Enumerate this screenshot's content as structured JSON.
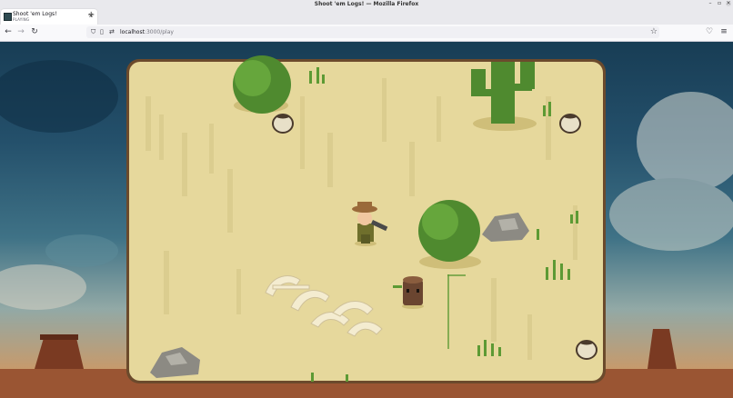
{
  "window": {
    "title": "Shoot 'em Logs! — Mozilla Firefox"
  },
  "tab": {
    "title": "Shoot 'em Logs!",
    "subtitle": "PLAYING",
    "close_icon": "close-icon"
  },
  "toolbar": {
    "back_icon": "back-arrow-icon",
    "forward_icon": "forward-arrow-icon",
    "reload_icon": "reload-icon",
    "pocket_icon": "pocket-icon",
    "menu_icon": "menu-icon"
  },
  "urlbar": {
    "host": "localhost",
    "path": ":3000/play",
    "shield_icon": "shield-icon",
    "page_icon": "page-icon",
    "permissions_icon": "permissions-icon",
    "bookmark_icon": "star-icon"
  },
  "game": {
    "sand_color": "#e6d89c",
    "frame_color": "#6b4a2c",
    "entities": [
      "player",
      "log-enemy",
      "cactus",
      "bush",
      "bush",
      "rock",
      "rock",
      "bones",
      "pot",
      "pot",
      "pot"
    ]
  }
}
